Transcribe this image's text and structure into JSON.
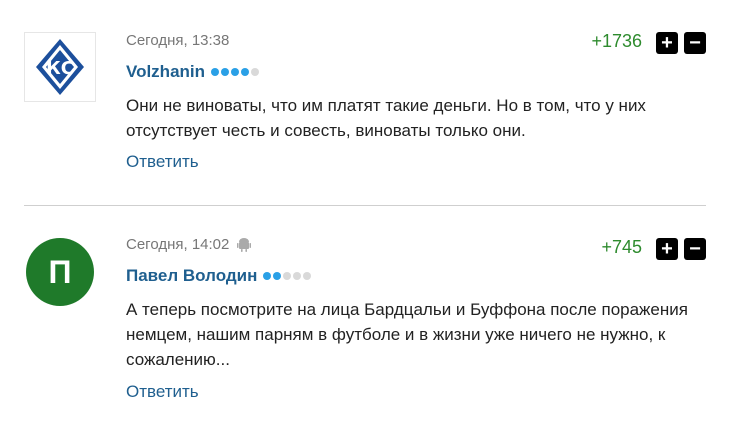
{
  "comments": [
    {
      "time": "Сегодня, 13:38",
      "author": "Volzhanin",
      "rating_dots_active": 4,
      "score": "+1736",
      "text": "Они не виноваты, что им платят такие деньги. Но в том, что у них отсутствует честь и совесть, виноваты только они.",
      "reply_label": "Ответить",
      "avatar_type": "club-logo"
    },
    {
      "time": "Сегодня, 14:02",
      "device_icon": "android-icon",
      "author": "Павел Володин",
      "rating_dots_active": 2,
      "score": "+745",
      "text": "А теперь посмотрите на лица Бардцальи и Буффона после поражения немцем, нашим парням в футболе и в жизни уже ничего не нужно, к сожалению...",
      "reply_label": "Ответить",
      "avatar_letter": "П"
    }
  ],
  "vote_up_symbol": "+",
  "vote_down_symbol": "−",
  "colors": {
    "score": "#2e8b2e",
    "author": "#1f5f8f",
    "avatar_bg": "#1f7a2a",
    "dot_active": "#2aa0e6"
  }
}
